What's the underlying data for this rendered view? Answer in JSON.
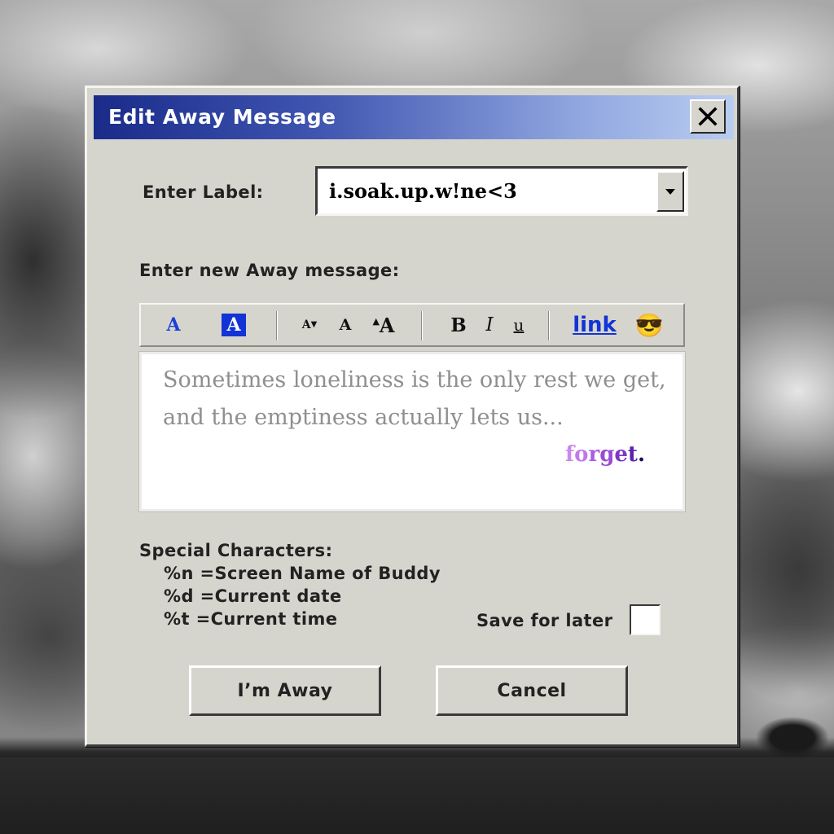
{
  "window": {
    "title": "Edit Away Message"
  },
  "label": {
    "prompt": "Enter Label:",
    "value": "i.soak.up.w!ne<3"
  },
  "message": {
    "prompt": "Enter new Away message:",
    "line1": "Sometimes loneliness is the only rest we get,",
    "line2": "and the emptiness actually lets us...",
    "highlight": {
      "letters": [
        "f",
        "o",
        "r",
        "g",
        "e",
        "t",
        "."
      ],
      "colors": [
        "#cc88ee",
        "#c07ae8",
        "#a95ee0",
        "#9a49d6",
        "#7f35c5",
        "#5b23a8",
        "#1c0a5c"
      ]
    }
  },
  "toolbar": {
    "text_color": "A",
    "bg_color": "A",
    "font_smaller": "A",
    "font_normal": "A",
    "font_larger": "A",
    "bold": "B",
    "italic": "I",
    "underline": "u",
    "link": "link",
    "emoji": "😎"
  },
  "special_chars": {
    "heading": "Special Characters:",
    "items": [
      "%n =Screen Name of Buddy",
      "%d =Current date",
      "%t =Current time"
    ]
  },
  "save_for_later": {
    "label": "Save for later",
    "checked": false
  },
  "buttons": {
    "away": "I’m Away",
    "cancel": "Cancel"
  },
  "colors": {
    "accent_blue": "#1233d6",
    "titlebar_start": "#1a2b8a",
    "titlebar_end": "#b9cdf0",
    "dialog_bg": "#d6d5cd"
  }
}
